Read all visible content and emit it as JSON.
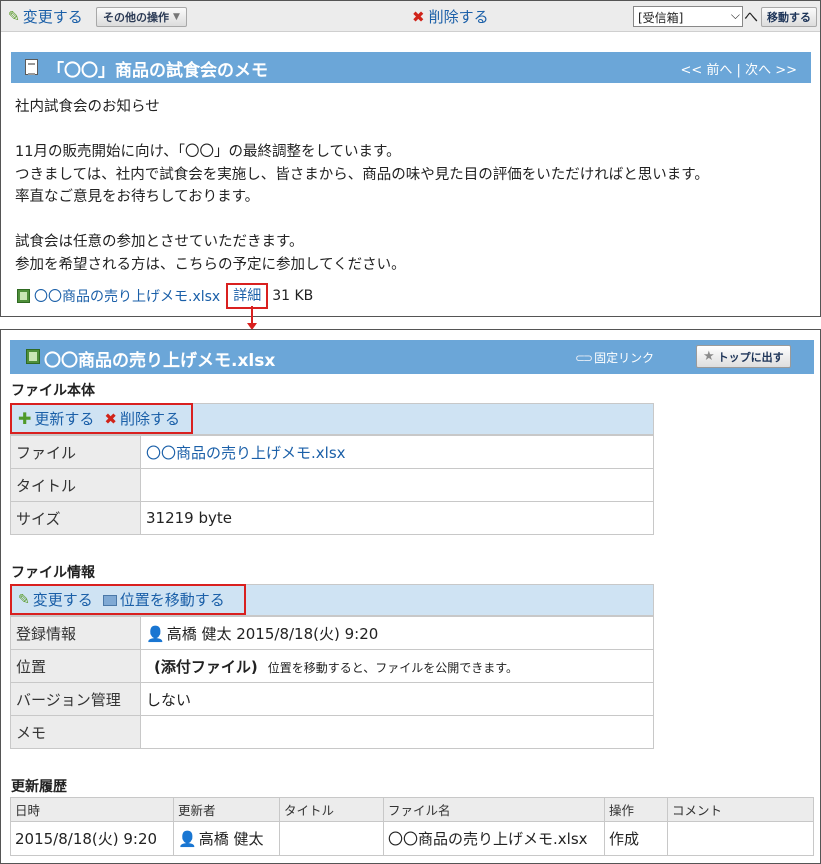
{
  "toolbar": {
    "edit_label": "変更する",
    "other_ops_label": "その他の操作",
    "delete_label": "削除する",
    "folder_selected": "[受信箱]",
    "to_label": "へ",
    "move_label": "移動する"
  },
  "message": {
    "title": "「〇〇」商品の試食会のメモ",
    "nav_prev": "<< 前へ",
    "nav_sep": "|",
    "nav_next": "次へ >>",
    "body_lines": [
      "社内試食会のお知らせ",
      "",
      "11月の販売開始に向け、「〇〇」の最終調整をしています。",
      "つきましては、社内で試食会を実施し、皆さまから、商品の味や見た目の評価をいただければと思います。",
      "率直なご意見をお待ちしております。",
      "",
      "試食会は任意の参加とさせていただきます。",
      "参加を希望される方は、こちらの予定に参加してください。"
    ],
    "attachment": {
      "name": "〇〇商品の売り上げメモ.xlsx",
      "detail_label": "詳細",
      "size": "31 KB"
    }
  },
  "file_page": {
    "title": "〇〇商品の売り上げメモ.xlsx",
    "permalink_label": "固定リンク",
    "top_button_label": "トップに出す",
    "body_section": {
      "title": "ファイル本体",
      "update_label": "更新する",
      "delete_label": "削除する",
      "rows": [
        {
          "key": "ファイル",
          "value": "〇〇商品の売り上げメモ.xlsx"
        },
        {
          "key": "タイトル",
          "value": ""
        },
        {
          "key": "サイズ",
          "value": "31219 byte"
        }
      ]
    },
    "info_section": {
      "title": "ファイル情報",
      "edit_label": "変更する",
      "move_label": "位置を移動する",
      "registration_key": "登録情報",
      "registration_value": "高橋 健太 2015/8/18(火) 9:20",
      "location_key": "位置",
      "location_value": "(添付ファイル)",
      "location_note": "位置を移動すると、ファイルを公開できます。",
      "version_key": "バージョン管理",
      "version_value": "しない",
      "memo_key": "メモ",
      "memo_value": ""
    },
    "history": {
      "title": "更新履歴",
      "headers": [
        "日時",
        "更新者",
        "タイトル",
        "ファイル名",
        "操作",
        "コメント"
      ],
      "rows": [
        {
          "date": "2015/8/18(火) 9:20",
          "user": "高橋 健太",
          "title": "",
          "filename": "〇〇商品の売り上げメモ.xlsx",
          "op": "作成",
          "comment": ""
        }
      ]
    }
  },
  "colors": {
    "header_blue": "#6ba6d8",
    "toolbar_light_blue": "#cfe3f3",
    "highlight_red": "#d9201f",
    "link_blue": "#1a5fa8"
  }
}
